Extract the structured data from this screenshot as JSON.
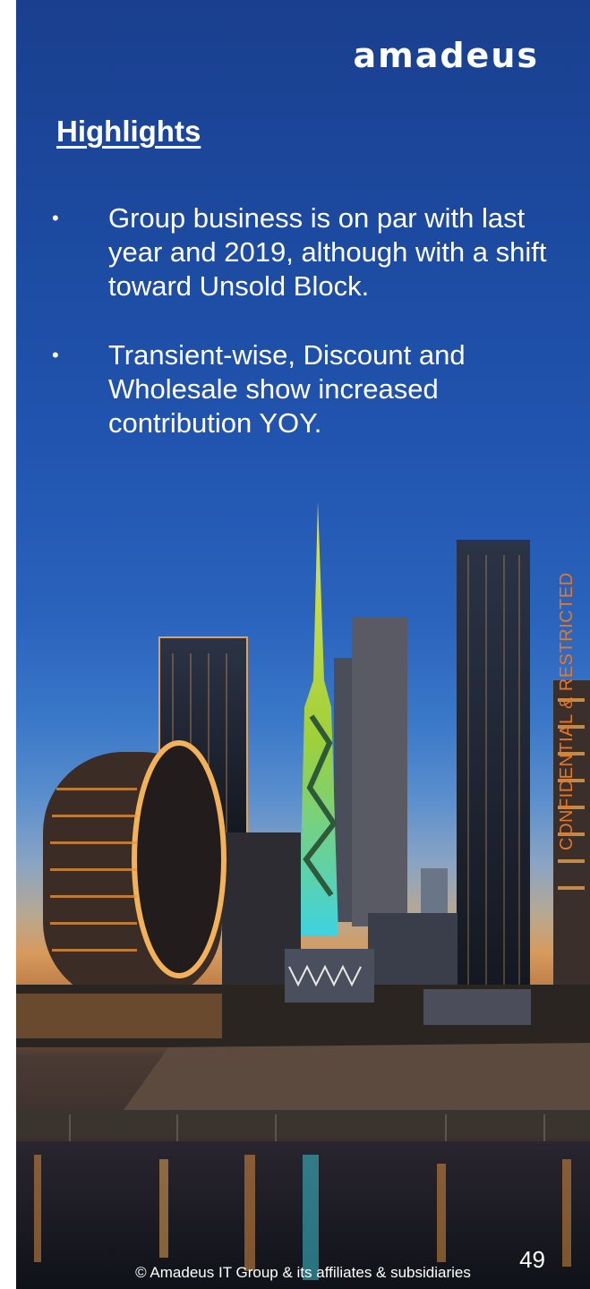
{
  "brand": {
    "logo_text": "amadeus"
  },
  "slide": {
    "heading": "Highlights",
    "bullets": [
      "Group business is on par with last year and 2019, although with a shift toward Unsold Block.",
      "Transient-wise, Discount and Wholesale show increased contribution YOY."
    ],
    "bullet_marker": "•",
    "classification_label": "CONFIDENTIAL & RESTRICTED",
    "page_number": "49",
    "copyright": "© Amadeus IT Group & its affiliates & subsidiaries"
  },
  "colors": {
    "text": "#ffffff",
    "classification": "#e87722",
    "sky_top": "#1a3f8e"
  }
}
